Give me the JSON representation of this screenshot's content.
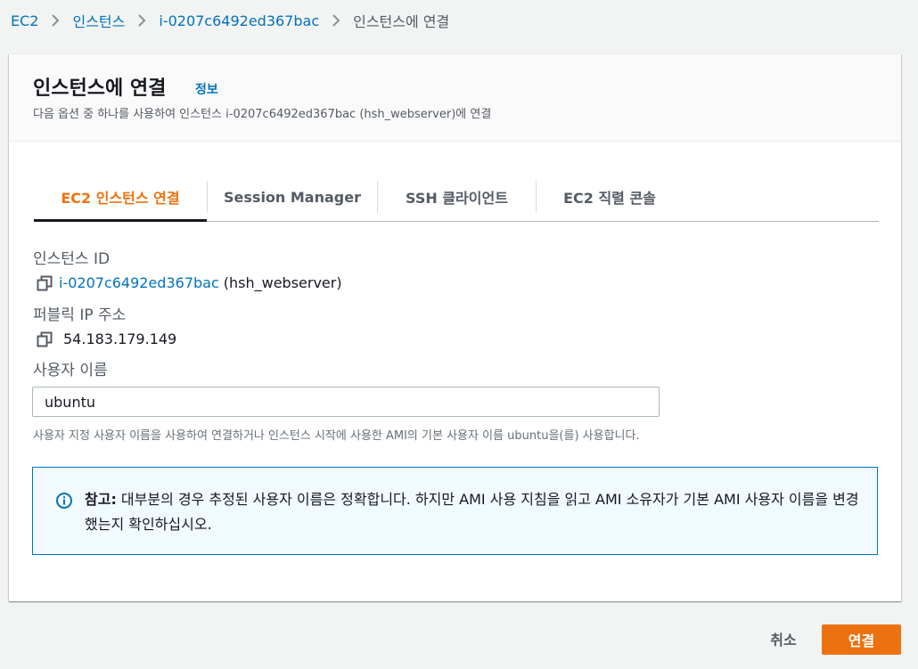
{
  "breadcrumb": {
    "items": [
      "EC2",
      "인스턴스",
      "i-0207c6492ed367bac"
    ],
    "current": "인스턴스에 연결"
  },
  "panel": {
    "title": "인스턴스에 연결",
    "info_link": "정보",
    "description": "다음 옵션 중 하나를 사용하여 인스턴스 i-0207c6492ed367bac (hsh_webserver)에 연결"
  },
  "tabs": [
    {
      "label": "EC2 인스턴스 연결",
      "active": true
    },
    {
      "label": "Session Manager",
      "active": false
    },
    {
      "label": "SSH 클라이언트",
      "active": false
    },
    {
      "label": "EC2 직렬 콘솔",
      "active": false
    }
  ],
  "fields": {
    "instance_id_label": "인스턴스 ID",
    "instance_id_value": "i-0207c6492ed367bac",
    "instance_name": "(hsh_webserver)",
    "public_ip_label": "퍼블릭 IP 주소",
    "public_ip_value": "54.183.179.149",
    "username_label": "사용자 이름",
    "username_value": "ubuntu",
    "username_hint": "사용자 지정 사용자 이름을 사용하여 연결하거나 인스턴스 시작에 사용한 AMI의 기본 사용자 이름 ubuntu을(를) 사용합니다."
  },
  "note": {
    "strong": "참고:",
    "text": " 대부분의 경우 추정된 사용자 이름은 정확합니다. 하지만 AMI 사용 지침을 읽고 AMI 소유자가 기본 AMI 사용자 이름을 변경했는지 확인하십시오."
  },
  "actions": {
    "cancel": "취소",
    "connect": "연결"
  },
  "colors": {
    "accent": "#ec7211",
    "link": "#0073bb",
    "info_bg": "#f1faff"
  },
  "icons": [
    "chevron-right-icon",
    "copy-icon",
    "info-circle-icon"
  ]
}
